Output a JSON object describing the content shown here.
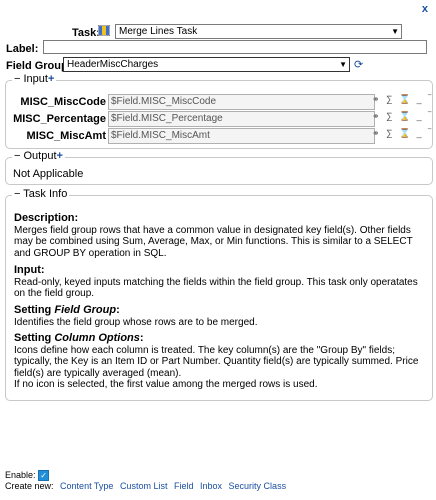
{
  "dialog": {
    "close_label": "x"
  },
  "task": {
    "label": "Task:",
    "value": "Merge Lines Task"
  },
  "name_field": {
    "label": "Label:",
    "value": ""
  },
  "field_group": {
    "label": "Field Group",
    "value": "HeaderMiscCharges"
  },
  "input_section": {
    "title": "Input",
    "rows": [
      {
        "label": "MISC_MiscCode",
        "value": "$Field.MISC_MiscCode"
      },
      {
        "label": "MISC_Percentage",
        "value": "$Field.MISC_Percentage"
      },
      {
        "label": "MISC_MiscAmt",
        "value": "$Field.MISC_MiscAmt"
      }
    ]
  },
  "output_section": {
    "title": "Output",
    "text": "Not Applicable"
  },
  "task_info": {
    "title": "Task Info",
    "description_heading": "Description:",
    "description": "Merges field group rows that have a common value in designated key field(s). Other fields may be combined using Sum, Average, Max, or Min functions. This is similar to a SELECT and GROUP BY operation in SQL.",
    "input_heading": "Input:",
    "input_text": "Read-only, keyed inputs matching the fields within the field group. This task only operatates on the field group.",
    "setting_fg_prefix": "Setting ",
    "setting_fg_em": "Field Group",
    "setting_fg_suffix": ":",
    "setting_fg_text": "Identifies the field group whose rows are to be merged.",
    "setting_co_prefix": "Setting ",
    "setting_co_em": "Column Options",
    "setting_co_suffix": ":",
    "setting_co_text": "Icons define how each column is treated. The key column(s) are the \"Group By\" fields; typically, the Key is an Item ID or Part Number. Quantity field(s) are typically summed. Price field(s) are typically averaged (mean).",
    "setting_co_text2": "If no icon is selected, the first value among the merged rows is used."
  },
  "footer": {
    "enable_label": "Enable:",
    "create_new_label": "Create new:",
    "links": [
      "Content Type",
      "Custom List",
      "Field",
      "Inbox",
      "Security Class"
    ]
  }
}
